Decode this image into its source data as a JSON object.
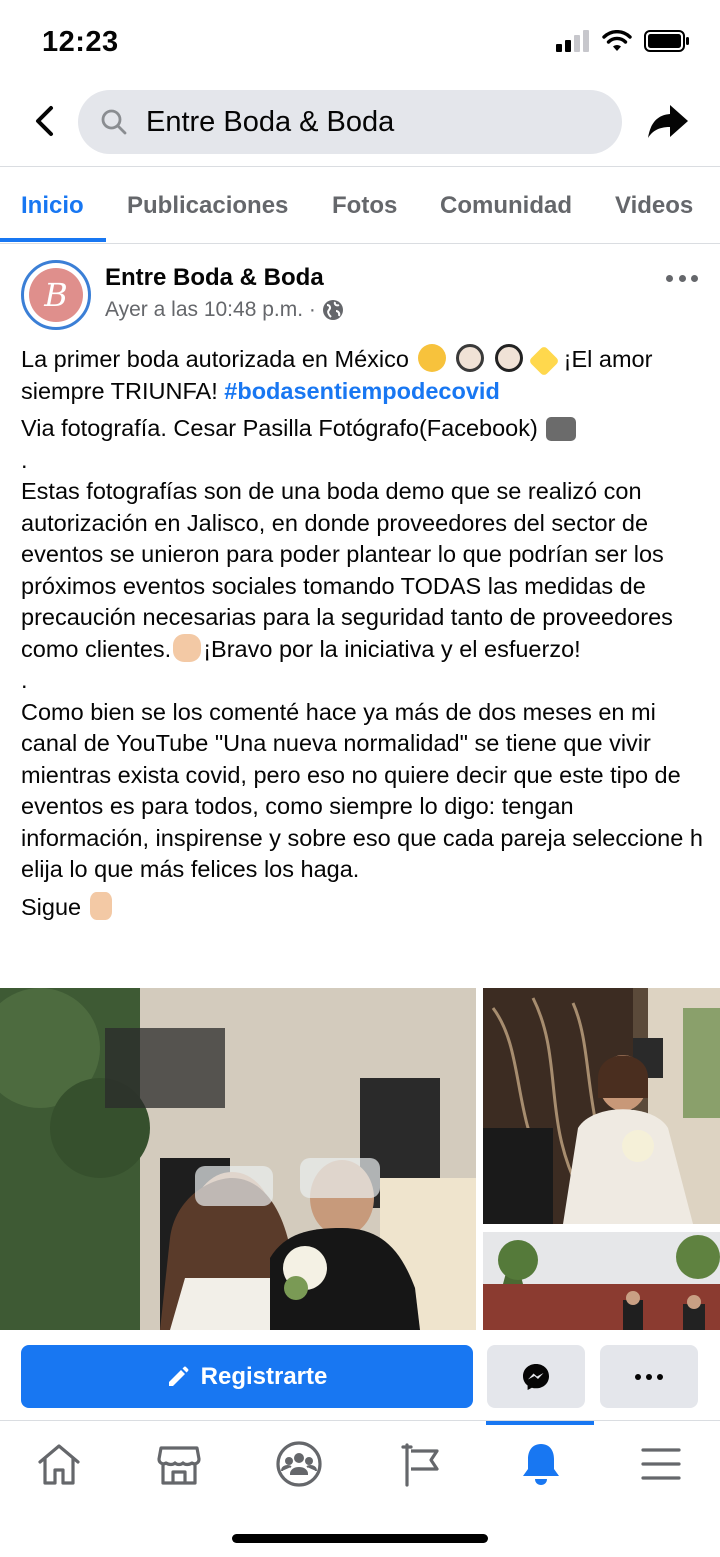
{
  "status": {
    "time": "12:23"
  },
  "search": {
    "query": "Entre Boda & Boda"
  },
  "tabs": [
    {
      "label": "Inicio",
      "active": true
    },
    {
      "label": "Publicaciones",
      "active": false
    },
    {
      "label": "Fotos",
      "active": false
    },
    {
      "label": "Comunidad",
      "active": false
    },
    {
      "label": "Videos",
      "active": false
    }
  ],
  "post": {
    "avatar_letter": "B",
    "page_name": "Entre Boda & Boda",
    "timestamp": "Ayer a las 10:48 p.m. ·",
    "line1_text": "La primer boda autorizada en México",
    "line1_tail": "¡El amor siempre TRIUNFA!",
    "hashtag": "#bodasentiempodecovid",
    "credit": "Via fotografía. Cesar Pasilla Fotógrafo(Facebook)",
    "dot1": ".",
    "para1a": "Estas fotografías son de una boda demo que se realizó con autorización en Jalisco, en donde proveedores del sector de eventos se unieron para poder plantear lo que podrían ser los próximos eventos sociales tomando TODAS las medidas de precaución necesarias para la seguridad tanto de proveedores como clientes.",
    "para1b": "¡Bravo por la iniciativa y el esfuerzo!",
    "dot2": ".",
    "para2": "Como bien se los comenté hace ya más de dos meses en mi canal de YouTube \"Una nueva normalidad\" se tiene que vivir mientras exista covid, pero eso no quiere decir que este tipo de eventos es para todos, como siempre lo digo: tengan información, inspirense y sobre eso que cada pareja seleccione h elija lo que más felices los haga.",
    "follow": "Sigue"
  },
  "actions": {
    "register_label": "Registrarte"
  },
  "bottom_nav": {
    "items": [
      "home-icon",
      "marketplace-icon",
      "groups-icon",
      "pages-flag-icon",
      "notifications-bell-icon",
      "menu-icon"
    ],
    "active": "notifications-bell-icon"
  },
  "colors": {
    "accent": "#1877f2",
    "secondary_text": "#65676b",
    "button_bg": "#e4e6eb"
  }
}
